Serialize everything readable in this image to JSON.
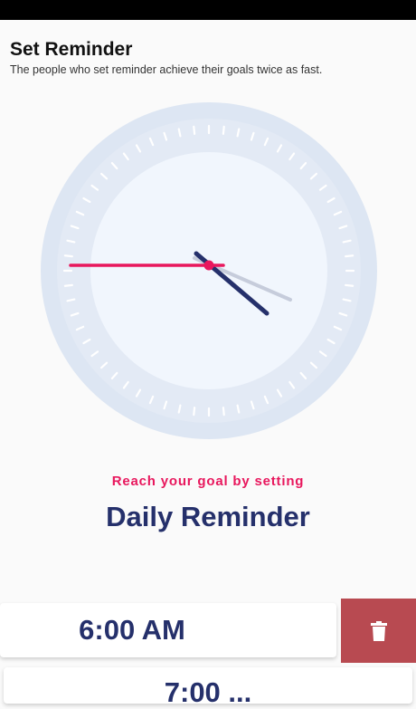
{
  "header": {
    "title": "Set Reminder",
    "subtitle": "The people who set reminder achieve their goals twice as fast."
  },
  "clock": {
    "time": "4:44:20",
    "colors": {
      "outer_ring": "#dde6f3",
      "face": "#f1f6fd",
      "hour_hand": "#25306b",
      "minute_hand": "#c6ccdb",
      "second_hand": "#e8175d"
    }
  },
  "promo": {
    "tagline": "Reach your goal by setting",
    "headline": "Daily Reminder"
  },
  "reminders": [
    {
      "time": "6:00 AM"
    },
    {
      "time": "7:00 ..."
    }
  ],
  "actions": {
    "delete_icon": "trash-icon",
    "delete_color": "#b84a51"
  }
}
